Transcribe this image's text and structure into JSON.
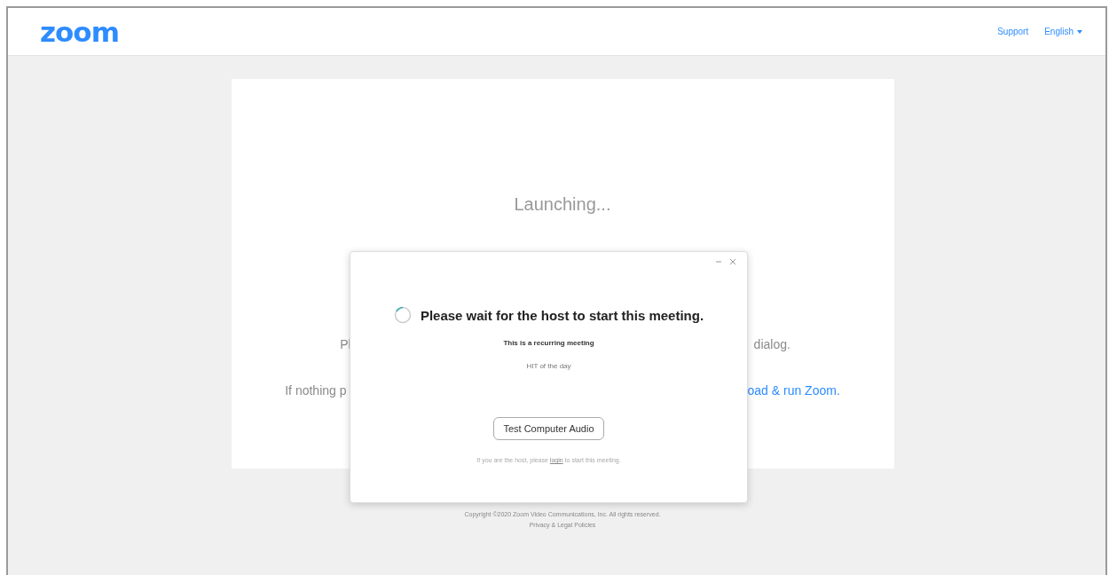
{
  "header": {
    "logo": "zoom",
    "links": [
      {
        "label": "Support",
        "kind": "link"
      },
      {
        "label": "English",
        "kind": "dropdown"
      }
    ]
  },
  "card": {
    "status": "Launching...",
    "line_1": {
      "left": "Pl",
      "right": "dialog."
    },
    "line_2": {
      "left": "If nothing p",
      "right": "oad & run Zoom."
    }
  },
  "dialog": {
    "heading": "Please wait for the host to start this meeting.",
    "subtitle": "This is a recurring meeting",
    "meeting_name": "HIT of the day",
    "button": "Test Computer Audio",
    "host_note": {
      "before": "If you are the host, please",
      "link": "login",
      "after": "to start this meeting."
    }
  },
  "footer": {
    "copyright": "Copyright ©2020 Zoom Video Communications, Inc. All rights reserved.",
    "policies": "Privacy & Legal Policies"
  }
}
